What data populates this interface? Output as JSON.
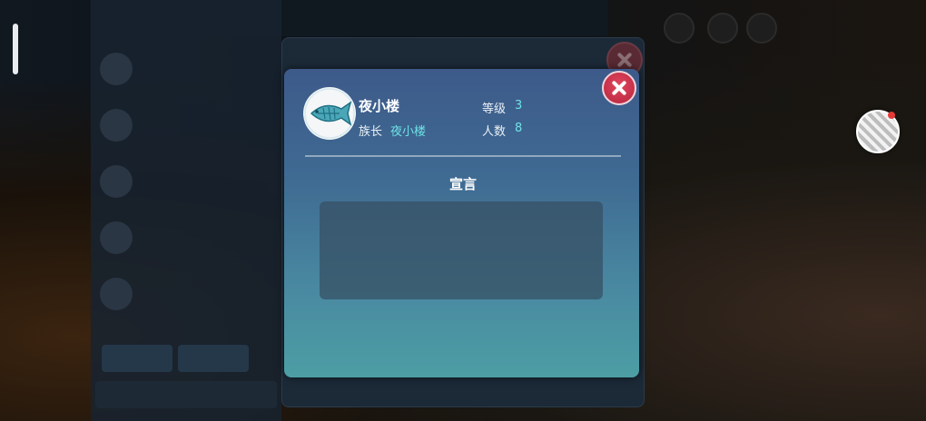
{
  "dialog": {
    "clan_name": "夜小楼",
    "leader_label": "族长",
    "leader_value": "夜小楼",
    "level_label": "等级",
    "level_value": "3",
    "member_count_label": "人数",
    "member_count_value": "8",
    "manifesto_title": "宣言",
    "manifesto_text": ""
  },
  "colors": {
    "accent_value": "#6ee2e6",
    "close_button": "#d23a52",
    "dialog_top": "#3d5a8a",
    "dialog_bottom": "#4c9ea4"
  },
  "icons": {
    "emblem": "fish-emblem-icon",
    "close": "close-icon"
  }
}
